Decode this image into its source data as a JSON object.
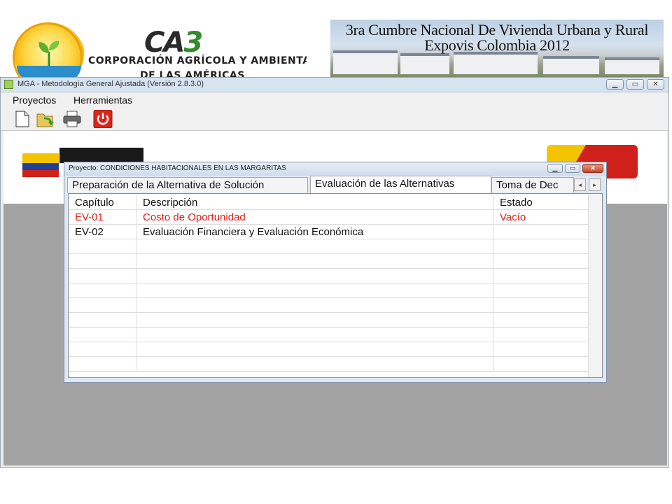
{
  "banner": {
    "org": {
      "mark_a": "CA",
      "mark_b": "3",
      "line1": "CORPORACIÓN AGRÍCOLA Y AMBIENTAL",
      "line2": "DE LAS AMÉRICAS"
    },
    "event": {
      "line1": "3ra Cumbre Nacional De Vivienda Urbana y Rural",
      "line2": "Expovis Colombia 2012"
    }
  },
  "app": {
    "title": "MGA - Metodología General Ajustada (Versión 2.8.3.0)",
    "menu": [
      "Proyectos",
      "Herramientas"
    ],
    "toolbar": [
      "new-document-icon",
      "open-folder-icon",
      "printer-icon",
      "power-off-icon"
    ]
  },
  "dialog": {
    "title": "Proyecto: CONDICIONES HABITACIONALES EN LAS MARGARITAS",
    "tabs": [
      {
        "label": "Preparación de la Alternativa de Solución",
        "active": false
      },
      {
        "label": "Evaluación de las Alternativas",
        "active": true
      },
      {
        "label": "Toma de Dec",
        "active": false
      }
    ],
    "table": {
      "columns": [
        "Capítulo",
        "Descripción",
        "Estado"
      ],
      "rows": [
        {
          "chapter": "EV-01",
          "description": "Costo de Oportunidad",
          "status": "Vacío",
          "color": "#e0201a"
        },
        {
          "chapter": "EV-02",
          "description": "Evaluación Financiera y Evaluación Económica",
          "status": "",
          "color": "#111111"
        }
      ]
    }
  },
  "colors": {
    "accent_red": "#e0201a",
    "app_background": "#a3a3a3",
    "titlebar": "#d6e3f1"
  }
}
